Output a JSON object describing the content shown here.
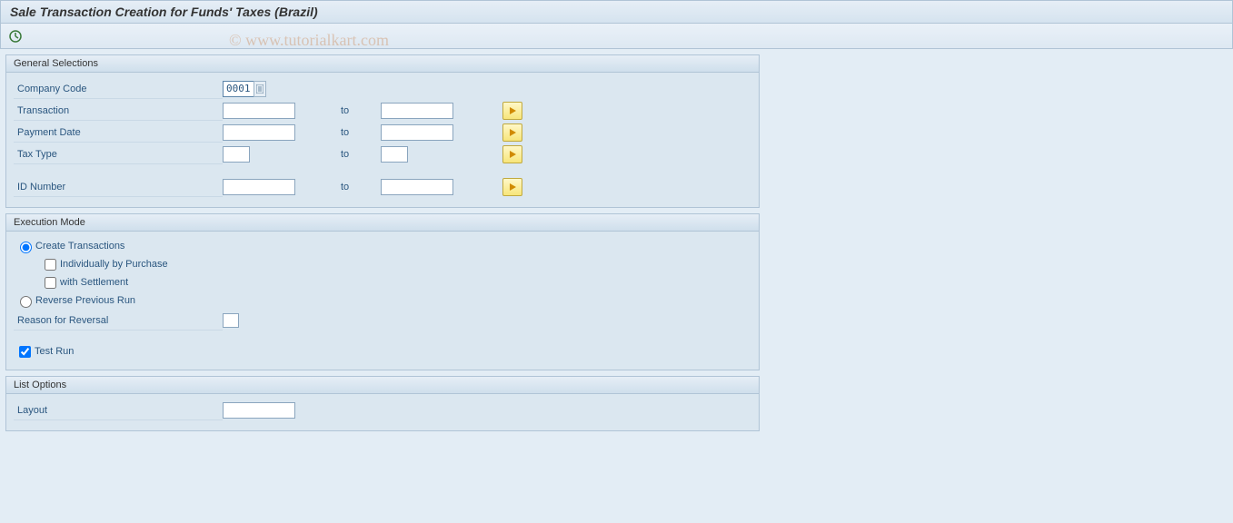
{
  "title": "Sale Transaction Creation for Funds' Taxes (Brazil)",
  "watermark": "© www.tutorialkart.com",
  "general": {
    "title": "General Selections",
    "company_code_label": "Company Code",
    "company_code_value": "0001",
    "transaction_label": "Transaction",
    "payment_date_label": "Payment Date",
    "tax_type_label": "Tax Type",
    "id_number_label": "ID Number",
    "to_label": "to"
  },
  "exec": {
    "title": "Execution Mode",
    "create_label": "Create Transactions",
    "indiv_label": "Individually by Purchase",
    "settle_label": "with Settlement",
    "reverse_label": "Reverse Previous Run",
    "reason_label": "Reason for Reversal",
    "testrun_label": "Test Run"
  },
  "list": {
    "title": "List Options",
    "layout_label": "Layout"
  }
}
